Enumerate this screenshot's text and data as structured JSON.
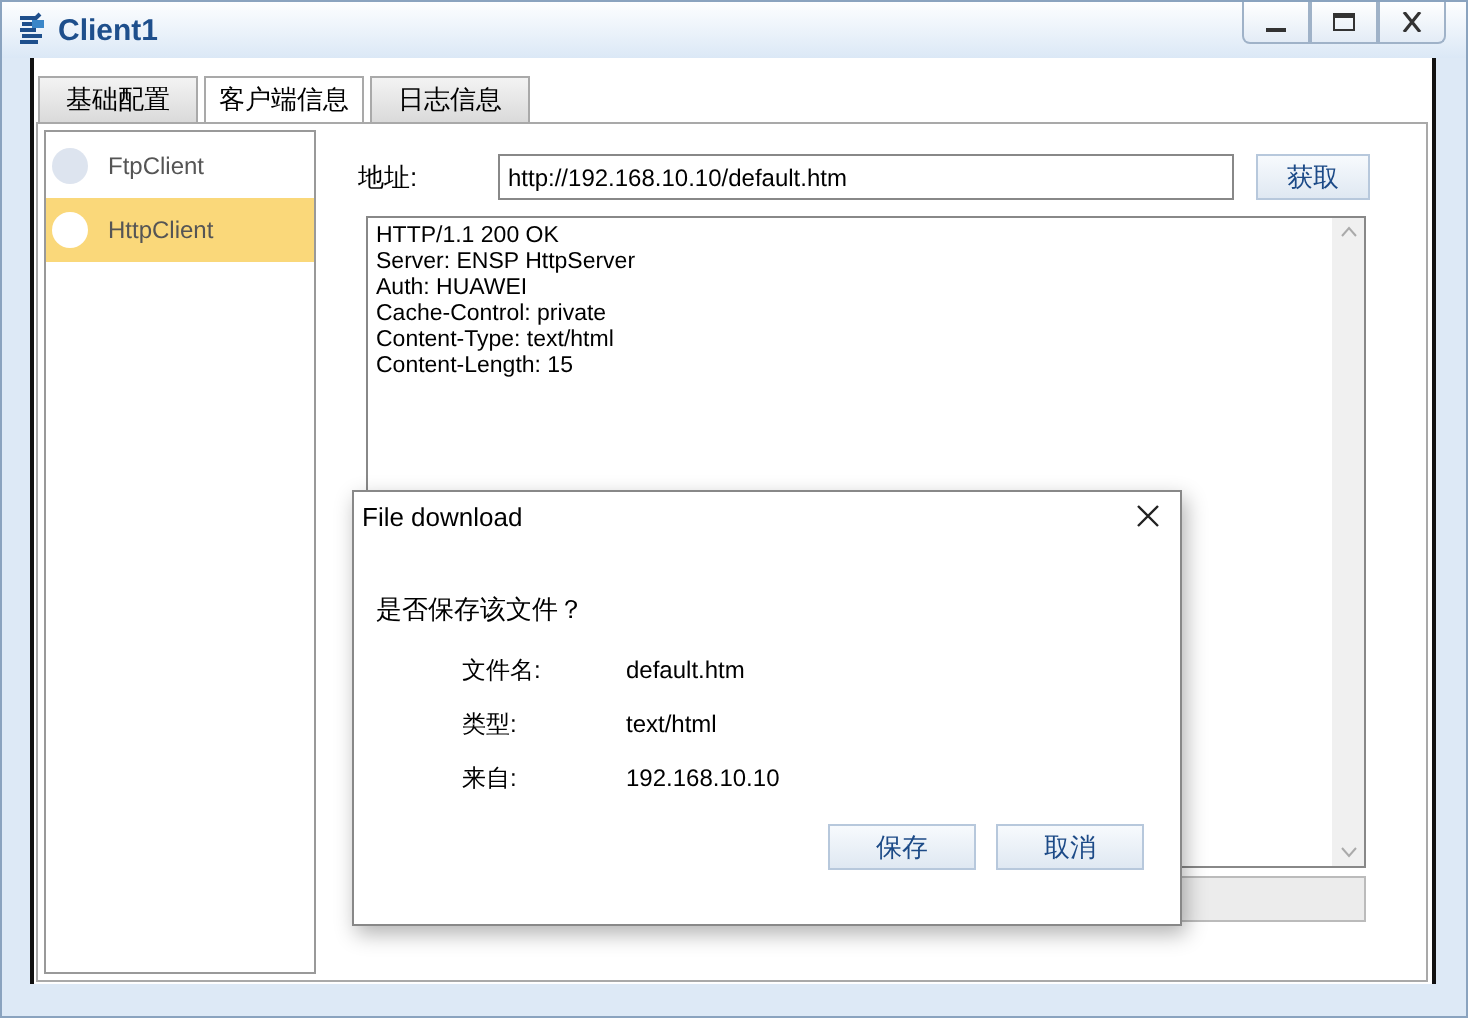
{
  "window": {
    "title": "Client1"
  },
  "tabs": [
    {
      "label": "基础配置",
      "selected": false
    },
    {
      "label": "客户端信息",
      "selected": true
    },
    {
      "label": "日志信息",
      "selected": false
    }
  ],
  "sidebar": {
    "items": [
      {
        "label": "FtpClient",
        "selected": false
      },
      {
        "label": "HttpClient",
        "selected": true
      }
    ]
  },
  "address": {
    "label": "地址:",
    "value": "http://192.168.10.10/default.htm"
  },
  "fetch_button": "获取",
  "response_lines": [
    "HTTP/1.1 200 OK",
    "Server: ENSP HttpServer",
    "Auth: HUAWEI",
    "Cache-Control: private",
    "Content-Type: text/html",
    "Content-Length: 15"
  ],
  "dialog": {
    "title": "File download",
    "question": "是否保存该文件？",
    "fields": [
      {
        "label": "文件名:",
        "value": "default.htm"
      },
      {
        "label": "类型:",
        "value": "text/html"
      },
      {
        "label": "来自:",
        "value": "192.168.10.10"
      }
    ],
    "buttons": [
      "保存",
      "取消"
    ]
  }
}
